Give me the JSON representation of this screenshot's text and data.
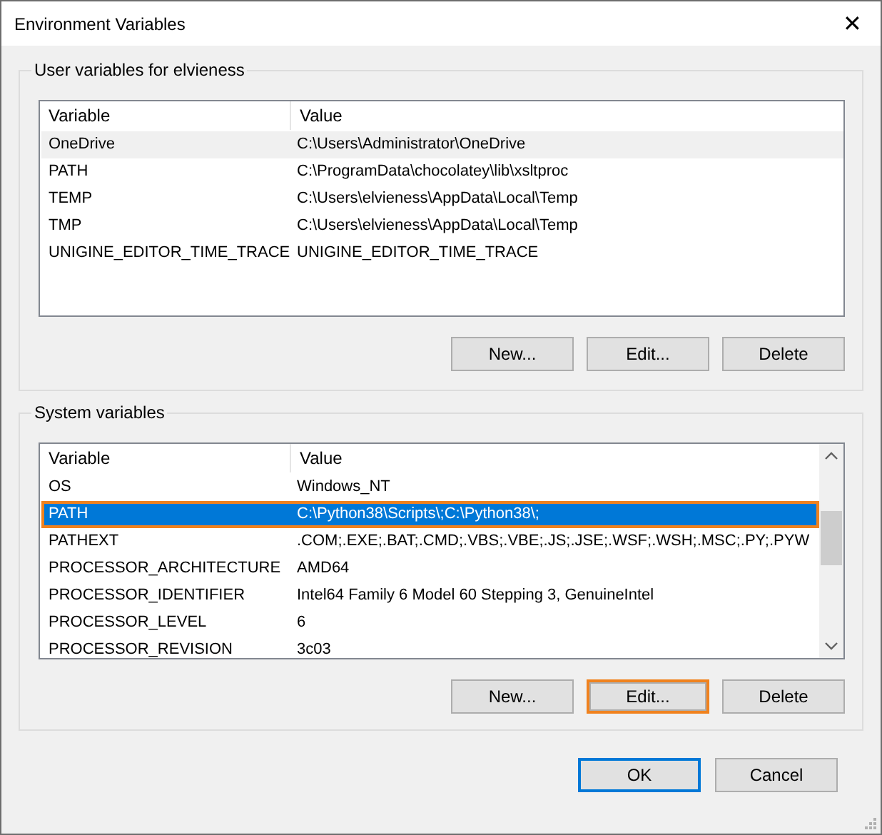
{
  "window": {
    "title": "Environment Variables",
    "close": "✕"
  },
  "groups": [
    {
      "title": "User variables for elvieness",
      "scrollbar": false,
      "focused": false,
      "columns": [
        "Variable",
        "Value"
      ],
      "rows": [
        {
          "variable": "OneDrive",
          "value": "C:\\Users\\Administrator\\OneDrive",
          "selected": true,
          "highlighted": false
        },
        {
          "variable": "PATH",
          "value": "C:\\ProgramData\\chocolatey\\lib\\xsltproc",
          "selected": false,
          "highlighted": false
        },
        {
          "variable": "TEMP",
          "value": "C:\\Users\\elvieness\\AppData\\Local\\Temp",
          "selected": false,
          "highlighted": false
        },
        {
          "variable": "TMP",
          "value": "C:\\Users\\elvieness\\AppData\\Local\\Temp",
          "selected": false,
          "highlighted": false
        },
        {
          "variable": "UNIGINE_EDITOR_TIME_TRACE",
          "value": "UNIGINE_EDITOR_TIME_TRACE",
          "selected": false,
          "highlighted": false
        }
      ],
      "buttons": [
        {
          "label": "New...",
          "highlighted": false
        },
        {
          "label": "Edit...",
          "highlighted": false
        },
        {
          "label": "Delete",
          "highlighted": false
        }
      ]
    },
    {
      "title": "System variables",
      "scrollbar": true,
      "focused": true,
      "columns": [
        "Variable",
        "Value"
      ],
      "rows": [
        {
          "variable": "OS",
          "value": "Windows_NT",
          "selected": false,
          "highlighted": false
        },
        {
          "variable": "PATH",
          "value": "C:\\Python38\\Scripts\\;C:\\Python38\\;",
          "selected": true,
          "highlighted": true
        },
        {
          "variable": "PATHEXT",
          "value": ".COM;.EXE;.BAT;.CMD;.VBS;.VBE;.JS;.JSE;.WSF;.WSH;.MSC;.PY;.PYW",
          "selected": false,
          "highlighted": false
        },
        {
          "variable": "PROCESSOR_ARCHITECTURE",
          "value": "AMD64",
          "selected": false,
          "highlighted": false
        },
        {
          "variable": "PROCESSOR_IDENTIFIER",
          "value": "Intel64 Family 6 Model 60 Stepping 3, GenuineIntel",
          "selected": false,
          "highlighted": false
        },
        {
          "variable": "PROCESSOR_LEVEL",
          "value": "6",
          "selected": false,
          "highlighted": false
        },
        {
          "variable": "PROCESSOR_REVISION",
          "value": "3c03",
          "selected": false,
          "highlighted": false
        }
      ],
      "buttons": [
        {
          "label": "New...",
          "highlighted": false
        },
        {
          "label": "Edit...",
          "highlighted": true
        },
        {
          "label": "Delete",
          "highlighted": false
        }
      ]
    }
  ],
  "footer": [
    {
      "label": "OK",
      "default": true
    },
    {
      "label": "Cancel",
      "default": false
    }
  ]
}
